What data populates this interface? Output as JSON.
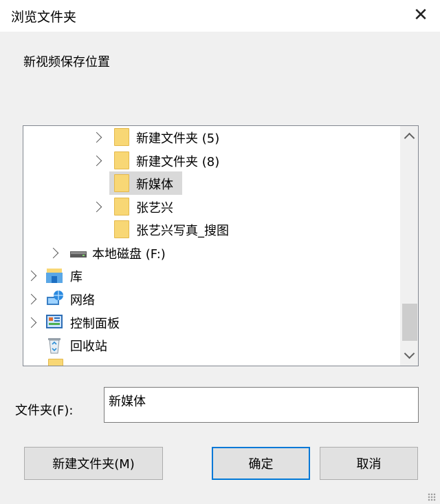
{
  "window": {
    "title": "浏览文件夹",
    "close_glyph": "✕"
  },
  "description": "新视频保存位置",
  "tree": {
    "items": [
      {
        "label": "新建文件夹 (5)",
        "icon": "folder-icon",
        "expandable": true
      },
      {
        "label": "新建文件夹 (8)",
        "icon": "folder-icon",
        "expandable": true
      },
      {
        "label": "新媒体",
        "icon": "folder-icon",
        "expandable": false,
        "selected": true
      },
      {
        "label": "张艺兴",
        "icon": "folder-icon",
        "expandable": true
      },
      {
        "label": "张艺兴写真_搜图",
        "icon": "folder-icon",
        "expandable": false
      },
      {
        "label": "本地磁盘 (F:)",
        "icon": "drive-icon",
        "expandable": true
      },
      {
        "label": "库",
        "icon": "library-icon",
        "expandable": true
      },
      {
        "label": "网络",
        "icon": "network-icon",
        "expandable": true
      },
      {
        "label": "控制面板",
        "icon": "control-panel-icon",
        "expandable": true
      },
      {
        "label": "回收站",
        "icon": "recycle-bin-icon",
        "expandable": false
      }
    ]
  },
  "folder_field": {
    "label": "文件夹(F):",
    "value": "新媒体"
  },
  "buttons": {
    "new_folder": "新建文件夹(M)",
    "ok": "确定",
    "cancel": "取消"
  },
  "colors": {
    "accent": "#0078d7",
    "folder": "#f8d775",
    "selection": "#d9d9d9"
  }
}
